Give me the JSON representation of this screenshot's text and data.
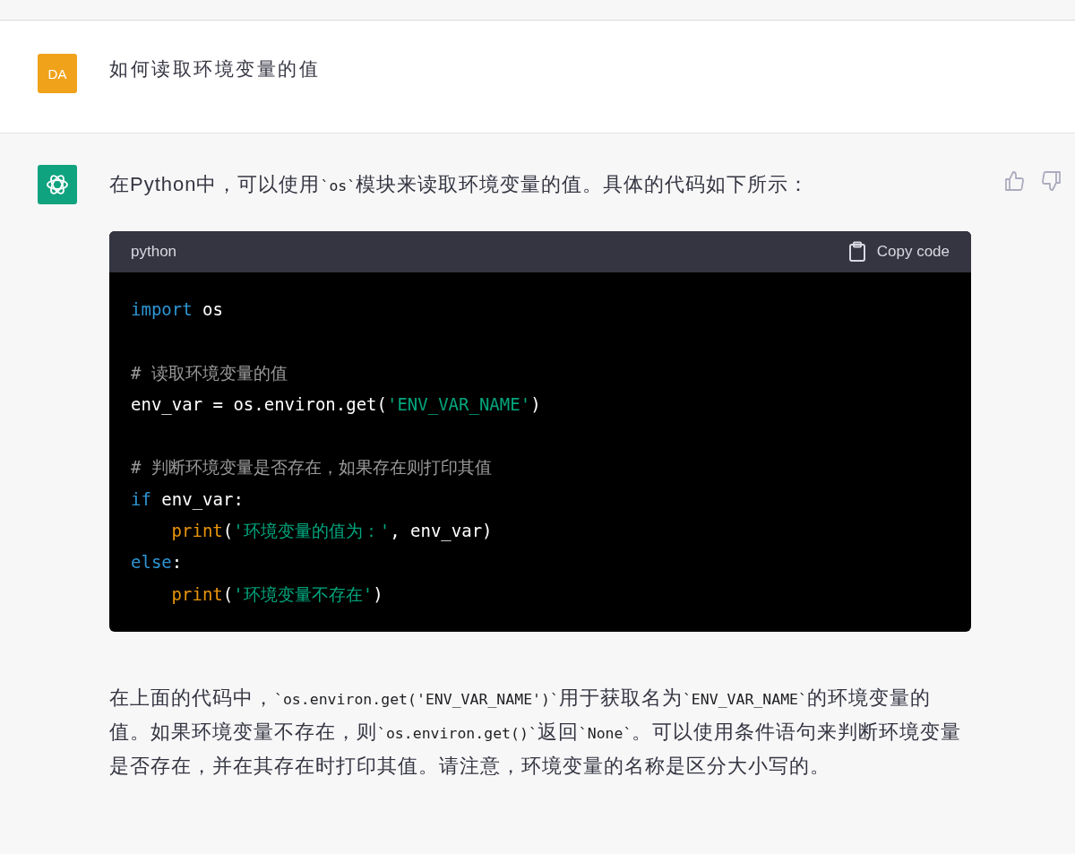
{
  "user_message": {
    "avatar": "DA",
    "text": "如何读取环境变量的值"
  },
  "assistant_message": {
    "intro": [
      {
        "kind": "text",
        "text": "在Python中，可以使用"
      },
      {
        "kind": "code",
        "text": "`os`"
      },
      {
        "kind": "text",
        "text": "模块来读取环境变量的值。具体的代码如下所示："
      }
    ],
    "code_block": {
      "language": "python",
      "copy_label": "Copy code",
      "lines": [
        {
          "kind": "code",
          "indented": false,
          "tokens": [
            {
              "kind": "keyword",
              "text": "import"
            },
            {
              "kind": "plain",
              "text": " os"
            }
          ]
        },
        {
          "kind": "blank"
        },
        {
          "kind": "code",
          "indented": false,
          "tokens": [
            {
              "kind": "comment",
              "text": "# 读取环境变量的值"
            }
          ]
        },
        {
          "kind": "code",
          "indented": false,
          "tokens": [
            {
              "kind": "plain",
              "text": "env_var = os.environ.get("
            },
            {
              "kind": "string",
              "text": "'ENV_VAR_NAME'"
            },
            {
              "kind": "plain",
              "text": ")"
            }
          ]
        },
        {
          "kind": "blank"
        },
        {
          "kind": "code",
          "indented": false,
          "tokens": [
            {
              "kind": "comment",
              "text": "# 判断环境变量是否存在，如果存在则打印其值"
            }
          ]
        },
        {
          "kind": "code",
          "indented": false,
          "tokens": [
            {
              "kind": "keyword",
              "text": "if"
            },
            {
              "kind": "plain",
              "text": " env_var:"
            }
          ]
        },
        {
          "kind": "code",
          "indented": true,
          "tokens": [
            {
              "kind": "builtin",
              "text": "print"
            },
            {
              "kind": "plain",
              "text": "("
            },
            {
              "kind": "string",
              "text": "'环境变量的值为：'"
            },
            {
              "kind": "plain",
              "text": ", env_var)"
            }
          ]
        },
        {
          "kind": "code",
          "indented": false,
          "tokens": [
            {
              "kind": "keyword",
              "text": "else"
            },
            {
              "kind": "plain",
              "text": ":"
            }
          ]
        },
        {
          "kind": "code",
          "indented": true,
          "tokens": [
            {
              "kind": "builtin",
              "text": "print"
            },
            {
              "kind": "plain",
              "text": "("
            },
            {
              "kind": "string",
              "text": "'环境变量不存在'"
            },
            {
              "kind": "plain",
              "text": ")"
            }
          ]
        }
      ]
    },
    "explanation": [
      {
        "kind": "text",
        "text": "在上面的代码中，"
      },
      {
        "kind": "code",
        "text": "`os.environ.get('ENV_VAR_NAME')`"
      },
      {
        "kind": "text",
        "text": "用于获取名为"
      },
      {
        "kind": "code",
        "text": "`ENV_VAR_NAME`"
      },
      {
        "kind": "text",
        "text": "的环境变量的值。如果环境变量不存在，则"
      },
      {
        "kind": "code",
        "text": "`os.environ.get()`"
      },
      {
        "kind": "text",
        "text": "返回"
      },
      {
        "kind": "code",
        "text": "`None`"
      },
      {
        "kind": "text",
        "text": "。可以使用条件语句来判断环境变量是否存在，并在其存在时打印其值。请注意，环境变量的名称是区分大小写的。"
      }
    ]
  }
}
